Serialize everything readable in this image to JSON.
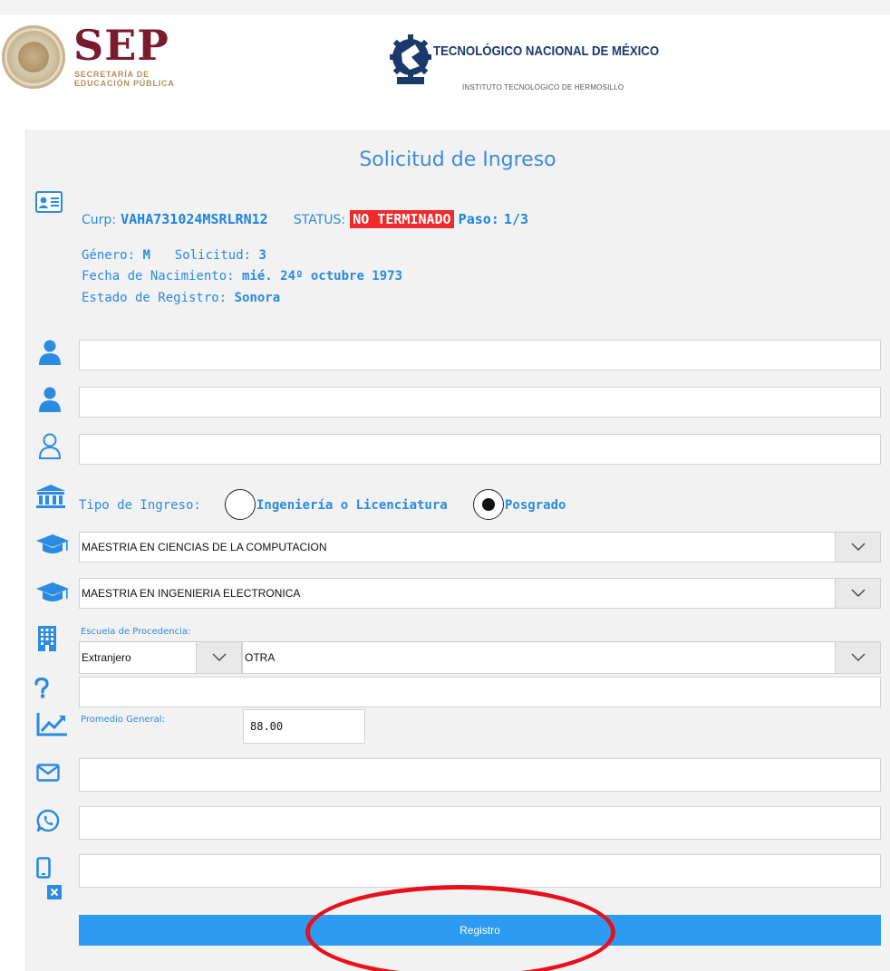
{
  "header": {
    "sep_brand": "SEP",
    "sep_line1": "SECRETARÍA DE",
    "sep_line2": "EDUCACIÓN PÚBLICA",
    "tec_title": "TECNOLÓGICO NACIONAL DE MÉXICO",
    "tec_subtitle": "INSTITUTO TECNOLÓGICO DE HERMOSILLO"
  },
  "form": {
    "title": "Solicitud de Ingreso",
    "curp_label": "Curp:",
    "curp_value": "VAHA731024MSRLRN12",
    "status_label": "STATUS:",
    "status_value": "NO TERMINADO",
    "paso_label": "Paso:",
    "paso_value": "1/3",
    "genero_label": "Género:",
    "genero_value": "M",
    "solicitud_label": "Solicitud:",
    "solicitud_value": "3",
    "fecha_label": "Fecha de Nacimiento:",
    "fecha_value": "mié. 24º octubre 1973",
    "estado_label": "Estado de Registro:",
    "estado_value": "Sonora",
    "nombre_value": "",
    "apellido1_value": "",
    "apellido2_value": "",
    "tipo_ingreso_label": "Tipo de Ingreso:",
    "tipo_option1": "Ingeniería o Licenciatura",
    "tipo_option2": "Posgrado",
    "tipo_selected": "Posgrado",
    "carrera1_value": "MAESTRIA EN CIENCIAS DE LA COMPUTACION",
    "carrera2_value": "MAESTRIA EN INGENIERIA ELECTRONICA",
    "escuela_label": "Escuela de Procedencia:",
    "escuela_estado_value": "Extranjero",
    "escuela_value": "OTRA",
    "escuela_otra_value": "",
    "promedio_label": "Promedio General:",
    "promedio_value": "88.00",
    "email_value": "",
    "whatsapp_value": "",
    "celular_value": "",
    "register_label": "Registro"
  },
  "colors": {
    "accent": "#2a8be0",
    "status_bg": "#f02a2a",
    "button": "#2d9bf0",
    "annotation": "#e8101a"
  },
  "icons": [
    "id-card-icon",
    "user-icon",
    "user-icon",
    "user-outline-icon",
    "bank-icon",
    "graduation-cap-icon",
    "graduation-cap-icon",
    "building-icon",
    "question-icon",
    "chart-line-icon",
    "envelope-icon",
    "whatsapp-icon",
    "mobile-icon",
    "close-icon",
    "chevron-down-icon"
  ]
}
